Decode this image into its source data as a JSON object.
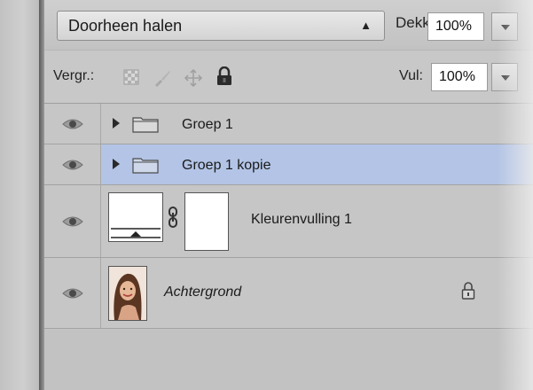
{
  "blend": {
    "mode": "Doorheen halen"
  },
  "opacity": {
    "label": "Dekking:",
    "value": "100%"
  },
  "lock": {
    "label": "Vergr.:"
  },
  "fill": {
    "label": "Vul:",
    "value": "100%"
  },
  "layers": [
    {
      "name": "Groep 1",
      "kind": "group",
      "visible": true,
      "selected": false
    },
    {
      "name": "Groep 1 kopie",
      "kind": "group",
      "visible": true,
      "selected": true
    },
    {
      "name": "Kleurenvulling 1",
      "kind": "fill-adjustment",
      "visible": true,
      "selected": false
    },
    {
      "name": "Achtergrond",
      "kind": "background",
      "visible": true,
      "selected": false,
      "locked": true
    }
  ],
  "colors": {
    "panel": "#c4c4c4",
    "selected_row": "#b3c4e6",
    "divider": "#5a5a5a"
  }
}
